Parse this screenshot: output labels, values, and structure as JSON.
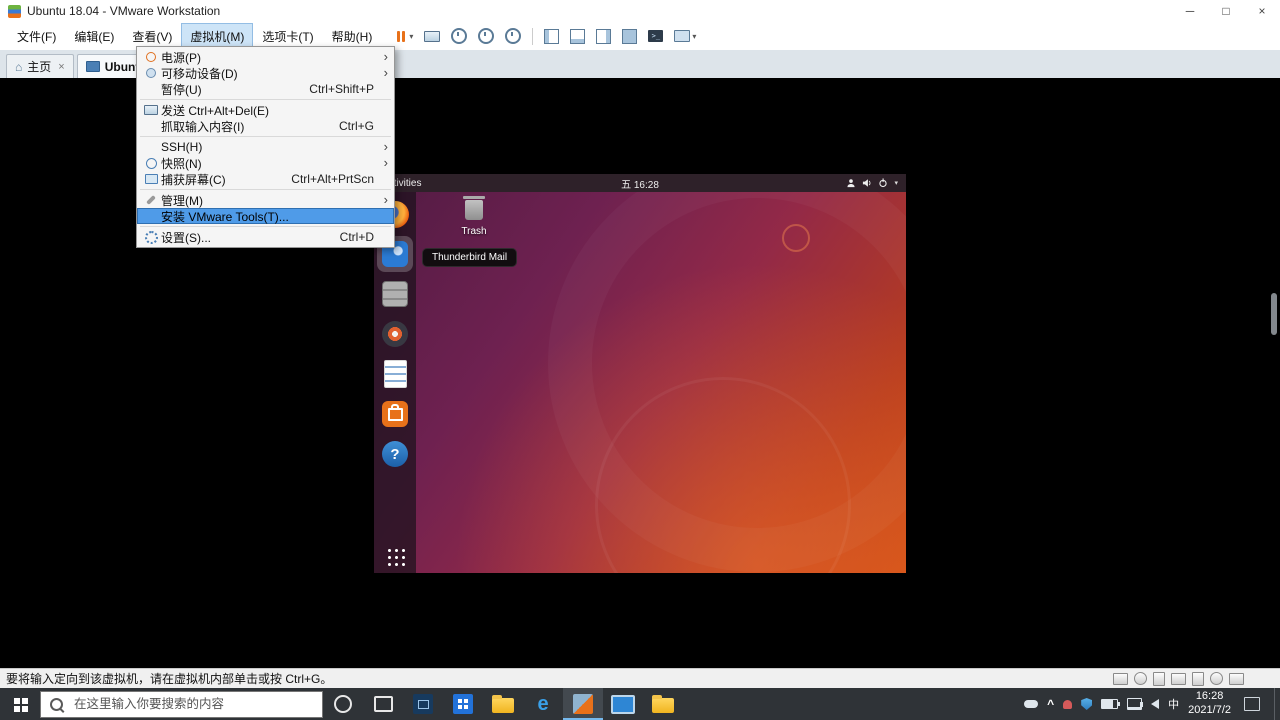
{
  "window": {
    "title": "Ubuntu 18.04 - VMware Workstation",
    "controls": {
      "minimize": "─",
      "maximize": "□",
      "close": "×"
    }
  },
  "menubar": {
    "items": [
      {
        "label": "文件(F)"
      },
      {
        "label": "编辑(E)"
      },
      {
        "label": "查看(V)"
      },
      {
        "label": "虚拟机(M)"
      },
      {
        "label": "选项卡(T)"
      },
      {
        "label": "帮助(H)"
      }
    ]
  },
  "vm_menu": {
    "items": [
      {
        "label": "电源(P)",
        "submenu": true
      },
      {
        "label": "可移动设备(D)",
        "submenu": true
      },
      {
        "label": "暂停(U)",
        "shortcut": "Ctrl+Shift+P"
      },
      {
        "label": "发送 Ctrl+Alt+Del(E)"
      },
      {
        "label": "抓取输入内容(I)",
        "shortcut": "Ctrl+G"
      },
      {
        "label": "SSH(H)",
        "submenu": true
      },
      {
        "label": "快照(N)",
        "submenu": true
      },
      {
        "label": "捕获屏幕(C)",
        "shortcut": "Ctrl+Alt+PrtScn"
      },
      {
        "label": "管理(M)",
        "submenu": true
      },
      {
        "label": "安装 VMware Tools(T)...",
        "highlighted": true
      },
      {
        "label": "设置(S)...",
        "shortcut": "Ctrl+D"
      }
    ]
  },
  "tabs": [
    {
      "label": "主页"
    },
    {
      "label": "Ubuntu 18.04",
      "active": true
    }
  ],
  "ubuntu": {
    "topbar": {
      "activities": "Activities",
      "clock": "五 16:28"
    },
    "desktop": {
      "trash_label": "Trash",
      "dock_tooltip": "Thunderbird Mail"
    },
    "dock_items": [
      "firefox",
      "thunderbird",
      "files",
      "rhythmbox",
      "libreoffice-writer",
      "ubuntu-software",
      "help",
      "show-applications"
    ]
  },
  "statusbar": {
    "message": "要将输入定向到该虚拟机，请在虚拟机内部单击或按 Ctrl+G。"
  },
  "taskbar": {
    "search_placeholder": "在这里输入你要搜索的内容",
    "tray": {
      "time": "16:28",
      "date": "2021/7/2",
      "input_indicator": "中",
      "caret": "^"
    }
  },
  "icons": {
    "caret_down": "▾",
    "submenu_arrow": "›",
    "close_small": "×",
    "home": "⌂",
    "console_glyph": ">_",
    "edge_glyph": "e",
    "help_glyph": "?"
  },
  "colors": {
    "menu_highlight": "#4f9be8",
    "ubuntu_orange": "#e8711a",
    "taskbar_bg": "#2f3337"
  }
}
